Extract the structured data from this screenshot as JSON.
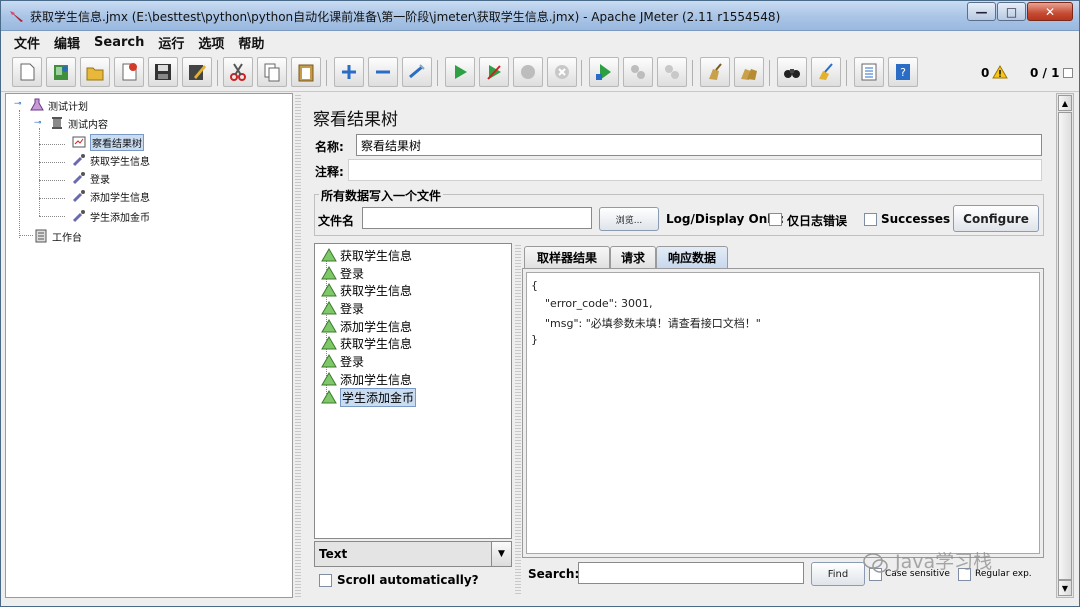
{
  "window": {
    "title": "获取学生信息.jmx (E:\\besttest\\python\\python自动化课前准备\\第一阶段\\jmeter\\获取学生信息.jmx) - Apache JMeter (2.11 r1554548)",
    "minimize_glyph": "—",
    "maximize_glyph": "□",
    "close_glyph": "✕"
  },
  "menu": [
    "文件",
    "编辑",
    "Search",
    "运行",
    "选项",
    "帮助"
  ],
  "toolbar": {
    "warning_count": "0",
    "threads": "0 / 1"
  },
  "tree": {
    "test_plan": "测试计划",
    "thread_group": "测试内容",
    "result_tree": "察看结果树",
    "sampler_get": "获取学生信息",
    "sampler_login": "登录",
    "sampler_add": "添加学生信息",
    "sampler_gold": "学生添加金币",
    "workbench": "工作台"
  },
  "panel": {
    "title": "察看结果树",
    "name_label": "名称:",
    "name_value": "察看结果树",
    "comment_label": "注释:",
    "comment_value": "",
    "file_group_title": "所有数据写入一个文件",
    "filename_label": "文件名",
    "filename_value": "",
    "browse_button": "浏览...",
    "log_display_label": "Log/Display Only:",
    "errors_only_label": "仅日志错误",
    "successes_label": "Successes",
    "configure_button": "Configure"
  },
  "results": {
    "items": [
      "获取学生信息",
      "登录",
      "获取学生信息",
      "登录",
      "添加学生信息",
      "获取学生信息",
      "登录",
      "添加学生信息",
      "学生添加金币"
    ],
    "renderer": "Text",
    "scroll_auto_label": "Scroll automatically?"
  },
  "tabs": [
    "取样器结果",
    "请求",
    "响应数据"
  ],
  "active_tab": "响应数据",
  "response": {
    "lines": [
      "{",
      "    \"error_code\": 3001,",
      "    \"msg\": \"必填参数未填！请查看接口文档！\"",
      "}"
    ]
  },
  "search": {
    "label": "Search:",
    "value": "",
    "find_button": "Find",
    "case_sensitive_label": "Case sensitive",
    "regex_label": "Regular exp."
  },
  "watermark": "Java学习栈"
}
